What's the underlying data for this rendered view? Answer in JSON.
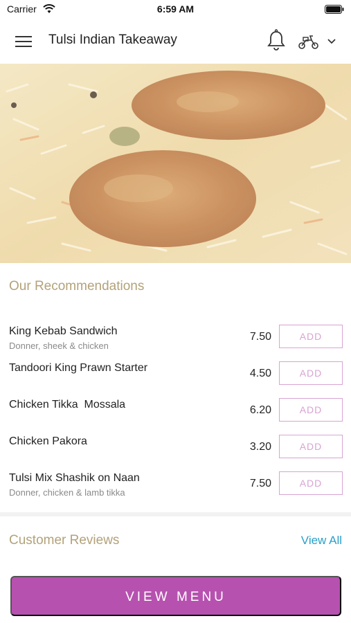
{
  "status_bar": {
    "carrier": "Carrier",
    "time": "6:59 AM"
  },
  "header": {
    "title": "Tulsi Indian Takeaway"
  },
  "hero": {
    "image": "biryani-chicken-photo"
  },
  "recommendations": {
    "title": "Our Recommendations",
    "items": [
      {
        "name": "King Kebab Sandwich",
        "description": "Donner, sheek & chicken",
        "price": "7.50",
        "add_label": "ADD"
      },
      {
        "name": "Tandoori King Prawn Starter",
        "description": "",
        "price": "4.50",
        "add_label": "ADD"
      },
      {
        "name": "Chicken Tikka  Mossala",
        "description": "",
        "price": "6.20",
        "add_label": "ADD"
      },
      {
        "name": "Chicken Pakora",
        "description": "",
        "price": "3.20",
        "add_label": "ADD"
      },
      {
        "name": "Tulsi Mix Shashik on Naan",
        "description": "Donner, chicken & lamb tikka",
        "price": "7.50",
        "add_label": "ADD"
      }
    ]
  },
  "reviews": {
    "title": "Customer Reviews",
    "view_all_label": "View All"
  },
  "footer": {
    "view_menu_label": "VIEW MENU"
  },
  "colors": {
    "accent": "#b751b0",
    "add_border": "#d9a3d3",
    "section_title": "#b3a27a",
    "link": "#2a9fc9"
  }
}
